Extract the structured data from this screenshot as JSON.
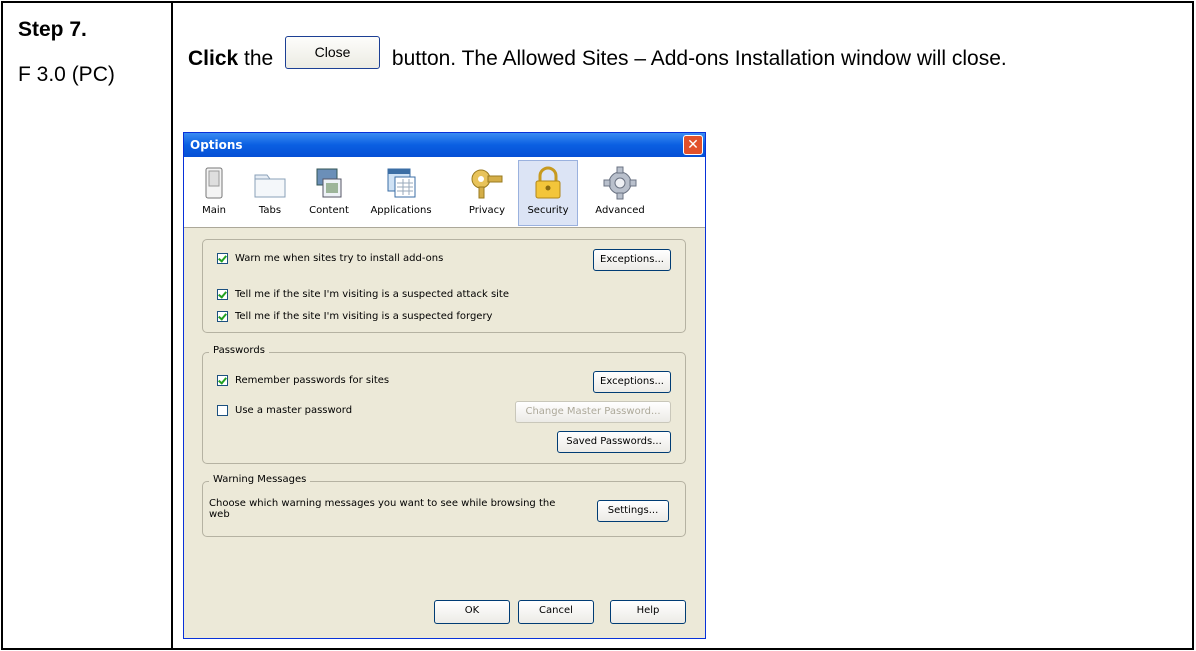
{
  "step": {
    "title": "Step 7.",
    "subtitle": "F 3.0 (PC)"
  },
  "instruction": {
    "verb": "Click",
    "pre": " the ",
    "button_label": "Close",
    "post": " button.  The Allowed Sites – Add-ons Installation window will close."
  },
  "dialog": {
    "title": "Options",
    "close_glyph": "✕",
    "tabs": [
      {
        "label": "Main",
        "icon": "switch-icon"
      },
      {
        "label": "Tabs",
        "icon": "folder-tab-icon"
      },
      {
        "label": "Content",
        "icon": "content-icon"
      },
      {
        "label": "Applications",
        "icon": "applications-icon"
      },
      {
        "label": "Privacy",
        "icon": "key-icon"
      },
      {
        "label": "Security",
        "icon": "lock-icon"
      },
      {
        "label": "Advanced",
        "icon": "gear-icon"
      }
    ],
    "selected_tab": "Security",
    "addons": {
      "warn_label": "Warn me when sites try to install add-ons",
      "warn_checked": true,
      "exceptions_label": "Exceptions...",
      "attack_label": "Tell me if the site I'm visiting is a suspected attack site",
      "attack_checked": true,
      "forgery_label": "Tell me if the site I'm visiting is a suspected forgery",
      "forgery_checked": true
    },
    "passwords": {
      "legend": "Passwords",
      "remember_label": "Remember passwords for sites",
      "remember_checked": true,
      "exceptions_label": "Exceptions...",
      "master_label": "Use a master password",
      "master_checked": false,
      "change_master_label": "Change Master Password...",
      "saved_label": "Saved Passwords..."
    },
    "warnings": {
      "legend": "Warning Messages",
      "text": "Choose which warning messages you want to see while browsing the web",
      "settings_label": "Settings..."
    },
    "footer": {
      "ok": "OK",
      "cancel": "Cancel",
      "help": "Help"
    }
  }
}
